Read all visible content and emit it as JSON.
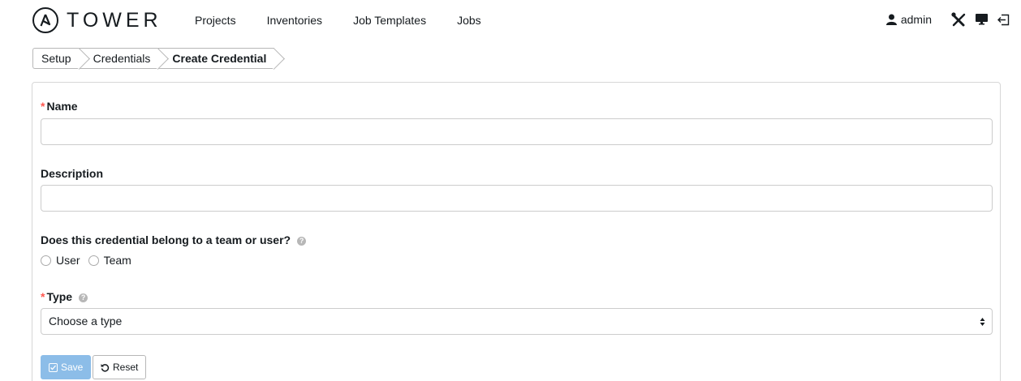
{
  "brand": {
    "name": "TOWER"
  },
  "nav": {
    "projects": "Projects",
    "inventories": "Inventories",
    "job_templates": "Job Templates",
    "jobs": "Jobs"
  },
  "user": {
    "name": "admin"
  },
  "icons": {
    "logo": "ansible-logo-icon",
    "user": "user-icon",
    "setup": "wrench-screwdriver-icon",
    "monitor": "monitor-icon",
    "logout": "logout-icon",
    "help": "question-circle-icon",
    "save": "check-square-icon",
    "reset": "undo-icon",
    "caret": "select-caret-icon"
  },
  "breadcrumb": {
    "setup": "Setup",
    "credentials": "Credentials",
    "current": "Create Credential"
  },
  "form": {
    "required_mark": "*",
    "name_label": "Name",
    "name_value": "",
    "description_label": "Description",
    "description_value": "",
    "owner_question": "Does this credential belong to a team or user?",
    "owner_options": [
      "User",
      "Team"
    ],
    "type_label": "Type",
    "type_placeholder": "Choose a type",
    "save_label": "Save",
    "reset_label": "Reset"
  },
  "colors": {
    "required": "#ff5850",
    "save_button": "#8cbde8",
    "text": "#161b1f"
  }
}
